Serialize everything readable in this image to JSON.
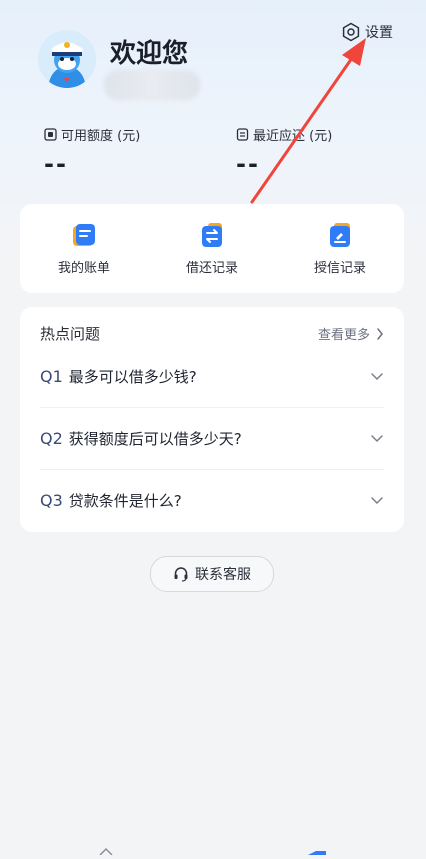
{
  "header": {
    "welcome": "欢迎您",
    "settings_label": "设置"
  },
  "metrics": {
    "available_label": "可用额度 (元)",
    "available_value": "--",
    "recent_label": "最近应还 (元)",
    "recent_value": "--"
  },
  "shortcuts": [
    {
      "label": "我的账单",
      "icon": "bill-icon"
    },
    {
      "label": "借还记录",
      "icon": "transfer-icon"
    },
    {
      "label": "授信记录",
      "icon": "credit-record-icon"
    }
  ],
  "faq": {
    "title": "热点问题",
    "more": "查看更多",
    "items": [
      {
        "num": "Q1",
        "text": "最多可以借多少钱?"
      },
      {
        "num": "Q2",
        "text": "获得额度后可以借多少天?"
      },
      {
        "num": "Q3",
        "text": "贷款条件是什么?"
      }
    ]
  },
  "service": {
    "label": "联系客服",
    "icon": "headset-icon"
  },
  "colors": {
    "accent": "#2f7cf6",
    "annotation_arrow": "#f0453a"
  }
}
